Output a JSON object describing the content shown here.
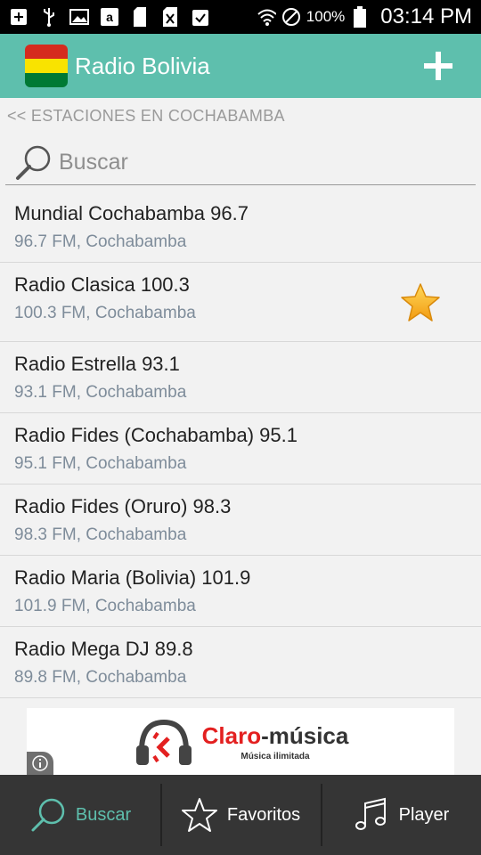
{
  "status_bar": {
    "battery": "100%",
    "time": "03:14 PM"
  },
  "app_bar": {
    "title": "Radio Bolivia",
    "flag_colors": [
      "#d52b1e",
      "#f9e300",
      "#007934"
    ]
  },
  "breadcrumb": "<< ESTACIONES EN COCHABAMBA",
  "search": {
    "placeholder": "Buscar"
  },
  "stations": [
    {
      "name": "Mundial Cochabamba 96.7",
      "detail": "96.7 FM, Cochabamba"
    },
    {
      "name": "Radio Clasica 100.3",
      "detail": "100.3 FM, Cochabamba",
      "favorite": true
    },
    {
      "name": "Radio Estrella 93.1",
      "detail": "93.1 FM, Cochabamba"
    },
    {
      "name": "Radio Fides (Cochabamba) 95.1",
      "detail": "95.1 FM, Cochabamba"
    },
    {
      "name": "Radio Fides (Oruro) 98.3",
      "detail": "98.3 FM, Cochabamba"
    },
    {
      "name": "Radio Maria (Bolivia) 101.9",
      "detail": "101.9 FM, Cochabamba"
    },
    {
      "name": "Radio Mega DJ 89.8",
      "detail": "89.8 FM, Cochabamba"
    }
  ],
  "ad": {
    "brand_part1": "Claro",
    "brand_part2": "-música",
    "tagline": "Música ilimitada"
  },
  "bottom_nav": {
    "search": "Buscar",
    "favorites": "Favoritos",
    "player": "Player"
  },
  "colors": {
    "accent": "#5ebfad",
    "bottom_nav": "#353535",
    "star": "#f5b324"
  }
}
